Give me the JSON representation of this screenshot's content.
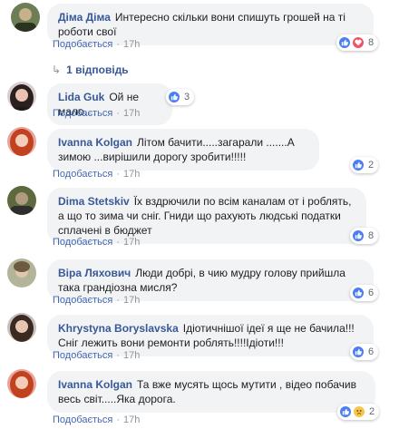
{
  "comments": [
    {
      "author": "Діма Діма",
      "text": "Интересно скільки вони спишуть грошей на ті роботи свої",
      "reply_label": "Подобається",
      "time": "17h",
      "reaction_count": "8",
      "reactions": [
        "like-icon",
        "love-icon"
      ]
    },
    {
      "author": "Lida Guk",
      "text": "Ой не мало....",
      "reply_label": "Подобається",
      "time": "17h",
      "reaction_count": "3",
      "reactions": [
        "like-icon"
      ]
    },
    {
      "author": "Ivanna Kolgan",
      "text": "Літом бачити.....загарали .......А зимою ...вирішили дорогу зробити!!!!!",
      "reply_label": "Подобається",
      "time": "17h",
      "reaction_count": "2",
      "reactions": [
        "like-icon"
      ]
    },
    {
      "author": "Dima Stetskiv",
      "text": "Їх вздрючили по всім каналам от і роблять, а що то зима чи сніг. Гниди що рахують людські податки сплачені в бюджет",
      "reply_label": "Подобається",
      "time": "17h",
      "reaction_count": "8",
      "reactions": [
        "like-icon"
      ]
    },
    {
      "author": "Віра Ляхович",
      "text": "Люди добрі, в чию мудру голову прийшла така грандіозна мисля?",
      "reply_label": "Подобається",
      "time": "17h",
      "reaction_count": "6",
      "reactions": [
        "like-icon"
      ]
    },
    {
      "author": "Khrystyna Boryslavska",
      "text": "Ідіотичнішої ідеї я ще не бачила!!!Сніг лежить вони ремонти роблять!!!!Ідіоти!!!",
      "reply_label": "Подобається",
      "time": "17h",
      "reaction_count": "6",
      "reactions": [
        "like-icon"
      ]
    },
    {
      "author": "Ivanna Kolgan",
      "text": "Та вже мусять щось мутити , відео побачив весь світ.....Яка дорога.",
      "reply_label": "Подобається",
      "time": "17h",
      "reaction_count": "2",
      "reactions": [
        "like-icon",
        "sad-icon"
      ]
    }
  ],
  "replies_link": "1 відповідь",
  "colors": {
    "author": "#385898",
    "bubble": "#f2f3f5",
    "like": "#4a7ff2",
    "love": "#f25268",
    "sad": "#f7c54a"
  }
}
